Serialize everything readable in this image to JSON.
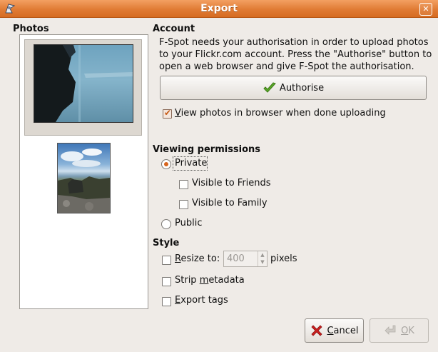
{
  "window": {
    "title": "Export",
    "close_symbol": "✕"
  },
  "photos": {
    "title": "Photos"
  },
  "account": {
    "title": "Account",
    "description": "F-Spot needs your authorisation in order to upload photos to your Flickr.com account. Press the \"Authorise\" button to open a web browser and give F-Spot the authorisation.",
    "authorise_label": "Authorise",
    "view_photos": {
      "label_prefix": "",
      "mnemonic": "V",
      "label_rest": "iew photos in browser when done uploading",
      "checked": true
    }
  },
  "viewing_permissions": {
    "title": "Viewing permissions",
    "private": {
      "label": "Private",
      "selected": true
    },
    "friends": {
      "label": "Visible to Friends",
      "checked": false
    },
    "family": {
      "label": "Visible to Family",
      "checked": false
    },
    "public": {
      "label": "Public",
      "selected": false
    }
  },
  "style": {
    "title": "Style",
    "resize": {
      "mnemonic": "R",
      "label_rest": "esize to:",
      "value": "400",
      "unit": "pixels",
      "checked": false
    },
    "strip": {
      "label_prefix": "Strip ",
      "mnemonic": "m",
      "label_rest": "etadata",
      "checked": false
    },
    "export_tags": {
      "mnemonic": "E",
      "label_rest": "xport tags",
      "checked": false
    }
  },
  "buttons": {
    "cancel": {
      "mnemonic": "C",
      "label_rest": "ancel"
    },
    "ok": {
      "mnemonic": "O",
      "label_rest": "K"
    }
  },
  "colors": {
    "titlebar": "#e07b34",
    "accent": "#d7641d",
    "cancel_icon": "#cc2020",
    "authorise_icon": "#5aa82a"
  }
}
